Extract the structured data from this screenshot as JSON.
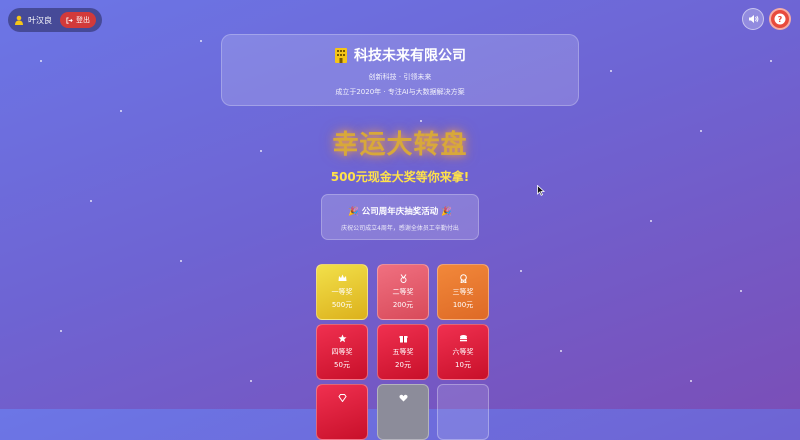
{
  "user": {
    "name": "叶汉良",
    "logout_label": "登出"
  },
  "company": {
    "name": "科技未来有限公司",
    "slogan": "创新科技 · 引领未来",
    "info": "成立于2020年 · 专注AI与大数据解决方案"
  },
  "lucky_title": "幸运大转盘",
  "prize_headline": "500元现金大奖等你来拿!",
  "event": {
    "title": "公司周年庆抽奖活动",
    "description": "庆祝公司成立4周年，感谢全体员工辛勤付出"
  },
  "prizes": [
    {
      "name": "一等奖",
      "value": "500元",
      "icon": "crown-icon"
    },
    {
      "name": "二等奖",
      "value": "200元",
      "icon": "medal-icon"
    },
    {
      "name": "三等奖",
      "value": "100元",
      "icon": "award-icon"
    },
    {
      "name": "四等奖",
      "value": "50元",
      "icon": "star-icon"
    },
    {
      "name": "五等奖",
      "value": "20元",
      "icon": "gift-icon"
    },
    {
      "name": "六等奖",
      "value": "10元",
      "icon": "coins-icon"
    }
  ],
  "colors": {
    "accent_gold": "#ffe14a",
    "logout_red": "#d23a3a",
    "help_red": "#e84a3c"
  }
}
